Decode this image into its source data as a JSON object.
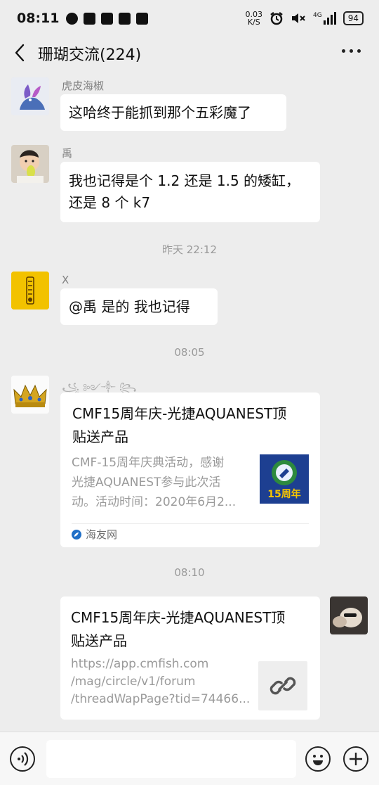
{
  "status_bar": {
    "time": "08:11",
    "network_speed": "0.03",
    "network_unit": "K/S",
    "signal_label": "4G",
    "battery": "94"
  },
  "header": {
    "title": "珊瑚交流(224)"
  },
  "messages": [
    {
      "sender": "虎皮海椒",
      "text": "这哈终于能抓到那个五彩魔了"
    },
    {
      "sender": "禹",
      "lines": [
        "我也记得是个 1.2 还是 1.5 的矮缸，",
        "还是 8 个 k7"
      ]
    },
    {
      "timestamp": "昨天 22:12"
    },
    {
      "sender": "X",
      "text": "@禹  是的 我也记得"
    },
    {
      "timestamp": "08:05"
    },
    {
      "sender": "꧁ ༻༒ ꧂",
      "card": {
        "title_lines": [
          "CMF15周年庆-光捷AQUANEST顶",
          "贴送产品"
        ],
        "desc_lines": [
          "CMF-15周年庆典活动，感谢",
          "光捷AQUANEST参与此次活",
          "动。活动时间：2020年6月2..."
        ],
        "thumb_text": "15周年",
        "source": "海友网"
      }
    },
    {
      "timestamp": "08:10"
    },
    {
      "card": {
        "title_lines": [
          "CMF15周年庆-光捷AQUANEST顶",
          "贴送产品"
        ],
        "desc_lines": [
          "https://app.cmfish.com",
          "/mag/circle/v1/forum",
          "/threadWapPage?tid=74466..."
        ]
      }
    }
  ],
  "colors": {
    "chat_background": "#ededed",
    "bubble": "#ffffff",
    "meta_text": "#9a9a9a",
    "x_avatar": "#f2c200"
  }
}
